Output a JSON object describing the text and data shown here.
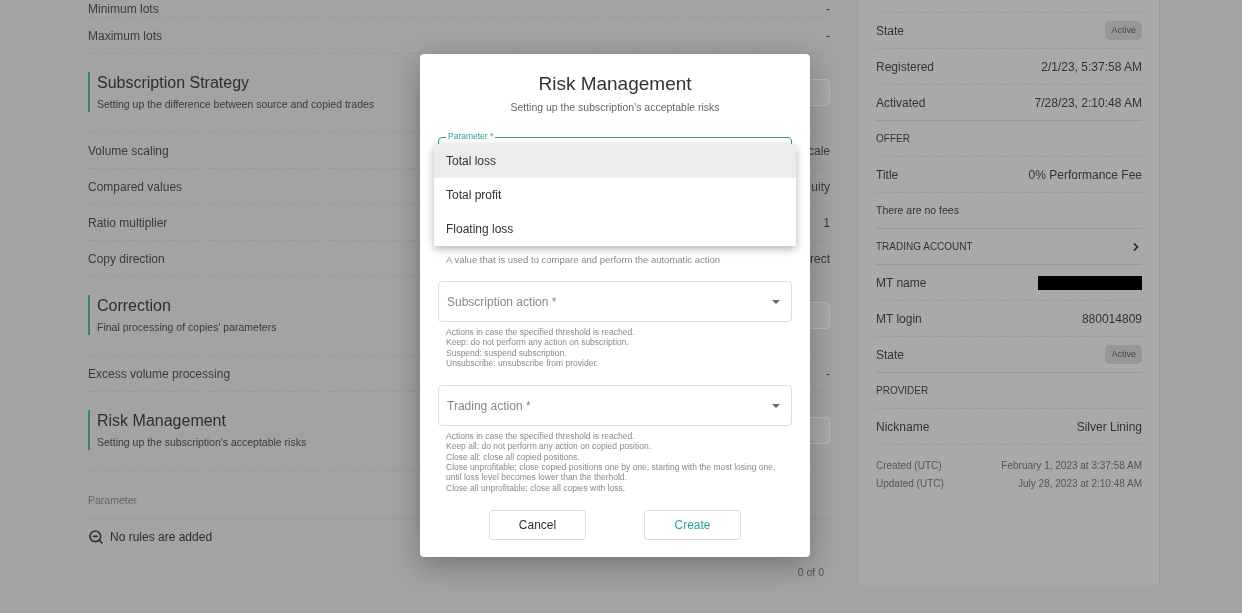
{
  "main": {
    "sections": [
      {
        "kind": "row",
        "label": "Minimum lots",
        "value": "-"
      },
      {
        "kind": "row",
        "label": "Maximum lots",
        "value": "-"
      },
      {
        "kind": "header",
        "title": "Subscription Strategy",
        "subtitle": "Setting up the difference between source and copied trades"
      },
      {
        "kind": "row",
        "label": "Volume scaling",
        "value": "cale"
      },
      {
        "kind": "row",
        "label": "Compared values",
        "value": "uity"
      },
      {
        "kind": "row",
        "label": "Ratio multiplier",
        "value": "1"
      },
      {
        "kind": "row",
        "label": "Copy direction",
        "value": "rect"
      },
      {
        "kind": "header",
        "title": "Correction",
        "subtitle": "Final processing of copies' parameters"
      },
      {
        "kind": "row",
        "label": "Excess volume processing",
        "value": "-"
      },
      {
        "kind": "header",
        "title": "Risk Management",
        "subtitle": "Setting up the subscription's acceptable risks"
      }
    ],
    "rules_table": {
      "columns": [
        "Parameter"
      ],
      "empty_text": "No rules are added",
      "pagination": "0 of 0"
    }
  },
  "details": {
    "items": [
      {
        "kind": "badge",
        "label": "State",
        "value": "Active"
      },
      {
        "kind": "row",
        "label": "Registered",
        "value": "2/1/23, 5:37:58 AM"
      },
      {
        "kind": "row",
        "label": "Activated",
        "value": "7/28/23, 2:10:48 AM"
      },
      {
        "kind": "heading",
        "label": "OFFER"
      },
      {
        "kind": "row",
        "label": "Title",
        "value": "0% Performance Fee"
      },
      {
        "kind": "note",
        "label": "There are no fees"
      },
      {
        "kind": "link_heading",
        "label": "TRADING ACCOUNT"
      },
      {
        "kind": "redacted",
        "label": "MT name"
      },
      {
        "kind": "row",
        "label": "MT login",
        "value": "880014809"
      },
      {
        "kind": "badge",
        "label": "State",
        "value": "Active"
      },
      {
        "kind": "heading",
        "label": "PROVIDER"
      },
      {
        "kind": "row",
        "label": "Nickname",
        "value": "Silver Lining"
      }
    ],
    "timestamps": [
      {
        "label": "Created (UTC)",
        "value": "February 1, 2023 at 3:37:58 AM"
      },
      {
        "label": "Updated (UTC)",
        "value": "July 28, 2023 at 2:10:48 AM"
      }
    ]
  },
  "dialog": {
    "title": "Risk Management",
    "subtitle": "Setting up the subscription's acceptable risks",
    "parameter": {
      "label": "Parameter *",
      "focused": true,
      "options": [
        {
          "label": "Total loss",
          "selected": true
        },
        {
          "label": "Total profit",
          "selected": false
        },
        {
          "label": "Floating loss",
          "selected": false
        }
      ],
      "helper": [
        "A value that is used to compare and perform the automatic action"
      ]
    },
    "fields": [
      {
        "placeholder": "Subscription action *",
        "helper": [
          "Actions in case the specified threshold is reached.",
          "Keep: do not perform any action on subscription.",
          "Suspend: suspend subscription.",
          "Unsubscribe: unsubscribe from provider."
        ]
      },
      {
        "placeholder": "Trading action *",
        "helper": [
          "Actions in case the specified threshold is reached.",
          "Keep all: do not perform any action on copied position.",
          "Close all: close all copied positions.",
          "Close unprofitable: close copied positions one by one, starting with the most losing one, until loss level becomes lower than the therhold.",
          "Close all unprofitable: close all copies with loss."
        ]
      }
    ],
    "buttons": [
      {
        "label": "Cancel",
        "kind": "secondary"
      },
      {
        "label": "Create",
        "kind": "primary"
      }
    ]
  }
}
